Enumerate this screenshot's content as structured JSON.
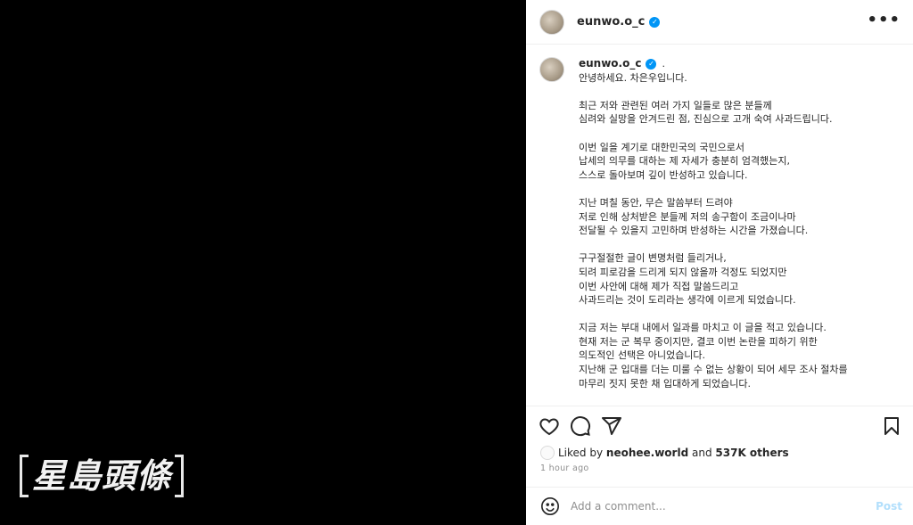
{
  "watermark": {
    "text": "星島頭條"
  },
  "header": {
    "username": "eunwo.o_c",
    "verified_glyph": "✓",
    "more_label": "•••"
  },
  "caption": {
    "username": "eunwo.o_c",
    "verified_glyph": "✓",
    "trailing": ".",
    "paragraphs": [
      [
        "안녕하세요. 차은우입니다."
      ],
      [
        "최근 저와 관련된 여러 가지 일들로 많은 분들께",
        "심려와 실망을 안겨드린 점, 진심으로 고개 숙여 사과드립니다."
      ],
      [
        "이번 일을 계기로 대한민국의 국민으로서",
        "납세의 의무를 대하는 제 자세가 충분히 엄격했는지,",
        "스스로 돌아보며 깊이 반성하고 있습니다."
      ],
      [
        "지난 며칠 동안, 무슨 말씀부터 드려야",
        "저로 인해 상처받은 분들께 저의 송구함이 조금이나마",
        "전달될 수 있을지 고민하며 반성하는 시간을 가졌습니다."
      ],
      [
        "구구절절한 글이 변명처럼 들리거나,",
        "되려 피로감을 드리게 되지 않을까 걱정도 되었지만",
        "이번 사안에 대해 제가 직접 말씀드리고",
        "사과드리는 것이 도리라는 생각에 이르게 되었습니다."
      ],
      [
        "지금 저는 부대 내에서 일과를 마치고 이 글을 적고 있습니다.",
        "현재 저는 군 복무 중이지만, 결코 이번 논란을 피하기 위한",
        "의도적인 선택은 아니었습니다.",
        "지난해 군 입대를 더는 미룰 수 없는 상황이 되어 세무 조사 절차를",
        "마무리 짓지 못한 채 입대하게 되었습니다."
      ]
    ]
  },
  "actions": {
    "icons": [
      "heart-icon",
      "comment-icon",
      "share-icon",
      "bookmark-icon"
    ]
  },
  "likes": {
    "prefix": "Liked by",
    "user": "neohee.world",
    "joiner": "and",
    "others": "537K others"
  },
  "time": {
    "label": "1 hour ago"
  },
  "comment": {
    "placeholder": "Add a comment...",
    "post_label": "Post"
  },
  "colors": {
    "accent": "#0095f6",
    "post_disabled": "#b2dffc",
    "text": "#262626",
    "muted": "#8e8e8e"
  }
}
